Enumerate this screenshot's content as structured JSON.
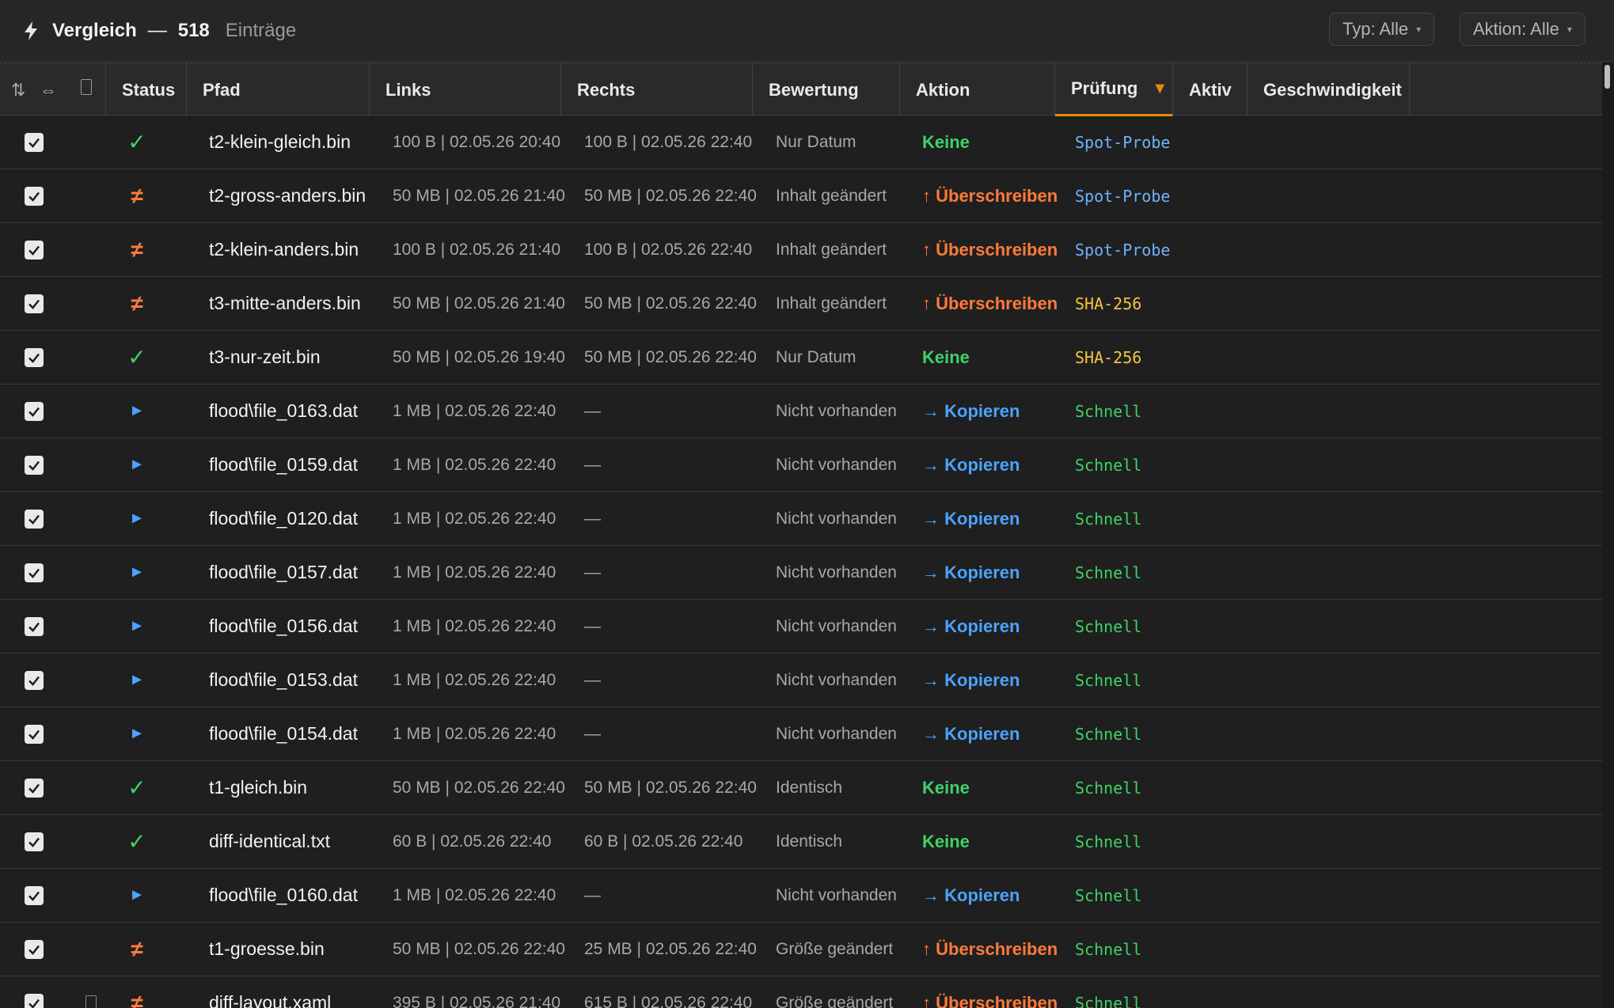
{
  "header": {
    "title": "Vergleich",
    "dash": "—",
    "count": "518",
    "count_label": "Einträge",
    "filter_type": "Typ: Alle",
    "filter_action": "Aktion: Alle",
    "caret": "▾"
  },
  "columns": {
    "status": "Status",
    "path": "Pfad",
    "left": "Links",
    "right": "Rechts",
    "eval": "Bewertung",
    "action": "Aktion",
    "check": "Prüfung",
    "active": "Aktiv",
    "speed": "Geschwindigkeit",
    "sort_indicator": "▼",
    "icon_sort": "⇅",
    "icon_swap": "⇔"
  },
  "colors": {
    "ok": "#3fd267",
    "diff": "#ff7a3a",
    "copy": "#4ba3ff",
    "sha": "#f4c542",
    "accent": "#e8890c"
  },
  "rows": [
    {
      "status": "✓",
      "kind": "ok",
      "path": "t2-klein-gleich.bin",
      "left": "100 B | 02.05.26 20:40",
      "right": "100 B | 02.05.26 22:40",
      "eval": "Nur Datum",
      "action": "Keine",
      "akind": "none",
      "check": "Spot-Probe",
      "ckind": "spot"
    },
    {
      "status": "≠",
      "kind": "diff",
      "path": "t2-gross-anders.bin",
      "left": "50 MB | 02.05.26 21:40",
      "right": "50 MB | 02.05.26 22:40",
      "eval": "Inhalt geändert",
      "action": "↑ Überschreiben",
      "akind": "over",
      "check": "Spot-Probe",
      "ckind": "spot"
    },
    {
      "status": "≠",
      "kind": "diff",
      "path": "t2-klein-anders.bin",
      "left": "100 B | 02.05.26 21:40",
      "right": "100 B | 02.05.26 22:40",
      "eval": "Inhalt geändert",
      "action": "↑ Überschreiben",
      "akind": "over",
      "check": "Spot-Probe",
      "ckind": "spot"
    },
    {
      "status": "≠",
      "kind": "diff",
      "path": "t3-mitte-anders.bin",
      "left": "50 MB | 02.05.26 21:40",
      "right": "50 MB | 02.05.26 22:40",
      "eval": "Inhalt geändert",
      "action": "↑ Überschreiben",
      "akind": "over",
      "check": "SHA-256",
      "ckind": "sha"
    },
    {
      "status": "✓",
      "kind": "ok",
      "path": "t3-nur-zeit.bin",
      "left": "50 MB | 02.05.26 19:40",
      "right": "50 MB | 02.05.26 22:40",
      "eval": "Nur Datum",
      "action": "Keine",
      "akind": "none",
      "check": "SHA-256",
      "ckind": "sha"
    },
    {
      "status": "►",
      "kind": "copy",
      "path": "flood\\file_0163.dat",
      "left": "1 MB | 02.05.26 22:40",
      "right": "—",
      "eval": "Nicht vorhanden",
      "action": "→ Kopieren",
      "akind": "copy",
      "check": "Schnell",
      "ckind": "fast"
    },
    {
      "status": "►",
      "kind": "copy",
      "path": "flood\\file_0159.dat",
      "left": "1 MB | 02.05.26 22:40",
      "right": "—",
      "eval": "Nicht vorhanden",
      "action": "→ Kopieren",
      "akind": "copy",
      "check": "Schnell",
      "ckind": "fast"
    },
    {
      "status": "►",
      "kind": "copy",
      "path": "flood\\file_0120.dat",
      "left": "1 MB | 02.05.26 22:40",
      "right": "—",
      "eval": "Nicht vorhanden",
      "action": "→ Kopieren",
      "akind": "copy",
      "check": "Schnell",
      "ckind": "fast"
    },
    {
      "status": "►",
      "kind": "copy",
      "path": "flood\\file_0157.dat",
      "left": "1 MB | 02.05.26 22:40",
      "right": "—",
      "eval": "Nicht vorhanden",
      "action": "→ Kopieren",
      "akind": "copy",
      "check": "Schnell",
      "ckind": "fast"
    },
    {
      "status": "►",
      "kind": "copy",
      "path": "flood\\file_0156.dat",
      "left": "1 MB | 02.05.26 22:40",
      "right": "—",
      "eval": "Nicht vorhanden",
      "action": "→ Kopieren",
      "akind": "copy",
      "check": "Schnell",
      "ckind": "fast"
    },
    {
      "status": "►",
      "kind": "copy",
      "path": "flood\\file_0153.dat",
      "left": "1 MB | 02.05.26 22:40",
      "right": "—",
      "eval": "Nicht vorhanden",
      "action": "→ Kopieren",
      "akind": "copy",
      "check": "Schnell",
      "ckind": "fast"
    },
    {
      "status": "►",
      "kind": "copy",
      "path": "flood\\file_0154.dat",
      "left": "1 MB | 02.05.26 22:40",
      "right": "—",
      "eval": "Nicht vorhanden",
      "action": "→ Kopieren",
      "akind": "copy",
      "check": "Schnell",
      "ckind": "fast"
    },
    {
      "status": "✓",
      "kind": "ok",
      "path": "t1-gleich.bin",
      "left": "50 MB | 02.05.26 22:40",
      "right": "50 MB | 02.05.26 22:40",
      "eval": "Identisch",
      "action": "Keine",
      "akind": "none",
      "check": "Schnell",
      "ckind": "fast"
    },
    {
      "status": "✓",
      "kind": "ok",
      "path": "diff-identical.txt",
      "left": "60 B | 02.05.26 22:40",
      "right": "60 B | 02.05.26 22:40",
      "eval": "Identisch",
      "action": "Keine",
      "akind": "none",
      "check": "Schnell",
      "ckind": "fast"
    },
    {
      "status": "►",
      "kind": "copy",
      "path": "flood\\file_0160.dat",
      "left": "1 MB | 02.05.26 22:40",
      "right": "—",
      "eval": "Nicht vorhanden",
      "action": "→ Kopieren",
      "akind": "copy",
      "check": "Schnell",
      "ckind": "fast"
    },
    {
      "status": "≠",
      "kind": "diff",
      "path": "t1-groesse.bin",
      "left": "50 MB | 02.05.26 22:40",
      "right": "25 MB | 02.05.26 22:40",
      "eval": "Größe geändert",
      "action": "↑ Überschreiben",
      "akind": "over",
      "check": "Schnell",
      "ckind": "fast"
    },
    {
      "status": "≠",
      "kind": "diff",
      "path": "diff-layout.xaml",
      "left": "395 B | 02.05.26 21:40",
      "right": "615 B | 02.05.26 22:40",
      "eval": "Größe geändert",
      "action": "↑ Überschreiben",
      "akind": "over",
      "check": "Schnell",
      "ckind": "fast"
    }
  ]
}
